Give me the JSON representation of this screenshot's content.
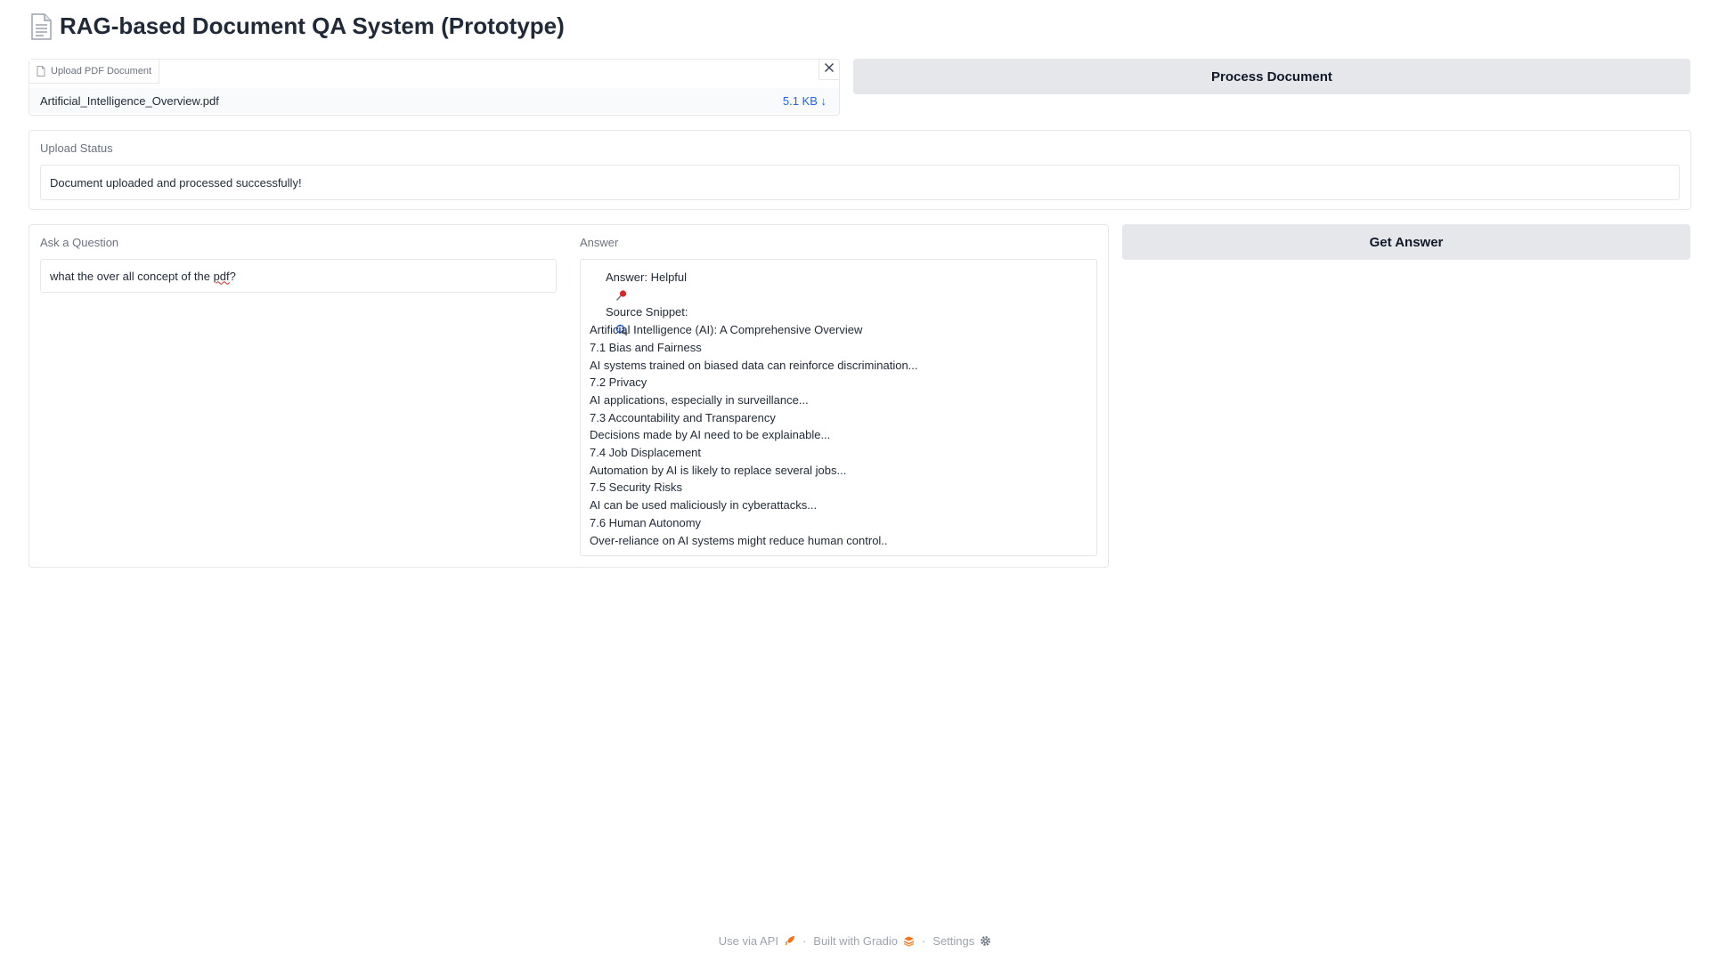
{
  "header": {
    "title": "RAG-based Document QA System (Prototype)",
    "icon": "page-document-icon"
  },
  "upload": {
    "tab_label": "Upload PDF Document",
    "file_name": "Artificial_Intelligence_Overview.pdf",
    "file_size": "5.1 KB ↓"
  },
  "buttons": {
    "process": "Process Document",
    "get_answer": "Get Answer"
  },
  "status": {
    "label": "Upload Status",
    "text": "Document uploaded and processed successfully!"
  },
  "question": {
    "label": "Ask a Question",
    "value_before": "what the over all concept of the ",
    "value_misspelled": "pdf",
    "value_after": "?"
  },
  "answer": {
    "label": "Answer",
    "lines": [
      {
        "icon": "pushpin-icon",
        "text": "Answer: Helpful"
      },
      {
        "icon": "",
        "text": ""
      },
      {
        "icon": "magnifier-icon",
        "text": "Source Snippet:"
      },
      {
        "icon": "",
        "text": "Artificial Intelligence (AI): A Comprehensive Overview"
      },
      {
        "icon": "",
        "text": "7.1 Bias and Fairness"
      },
      {
        "icon": "",
        "text": "AI systems trained on biased data can reinforce discrimination..."
      },
      {
        "icon": "",
        "text": "7.2 Privacy"
      },
      {
        "icon": "",
        "text": "AI applications, especially in surveillance..."
      },
      {
        "icon": "",
        "text": "7.3 Accountability and Transparency"
      },
      {
        "icon": "",
        "text": "Decisions made by AI need to be explainable..."
      },
      {
        "icon": "",
        "text": "7.4 Job Displacement"
      },
      {
        "icon": "",
        "text": "Automation by AI is likely to replace several jobs..."
      },
      {
        "icon": "",
        "text": "7.5 Security Risks"
      },
      {
        "icon": "",
        "text": "AI can be used maliciously in cyberattacks..."
      },
      {
        "icon": "",
        "text": "7.6 Human Autonomy"
      },
      {
        "icon": "",
        "text": "Over-reliance on AI systems might reduce human control.."
      }
    ]
  },
  "footer": {
    "api": "Use via API",
    "built": "Built with Gradio",
    "settings": "Settings",
    "separator": "·"
  },
  "colors": {
    "accent_blue": "#2563eb",
    "button_bg": "#e5e7eb",
    "border": "#e5e7eb",
    "muted_text": "#6b7280"
  }
}
